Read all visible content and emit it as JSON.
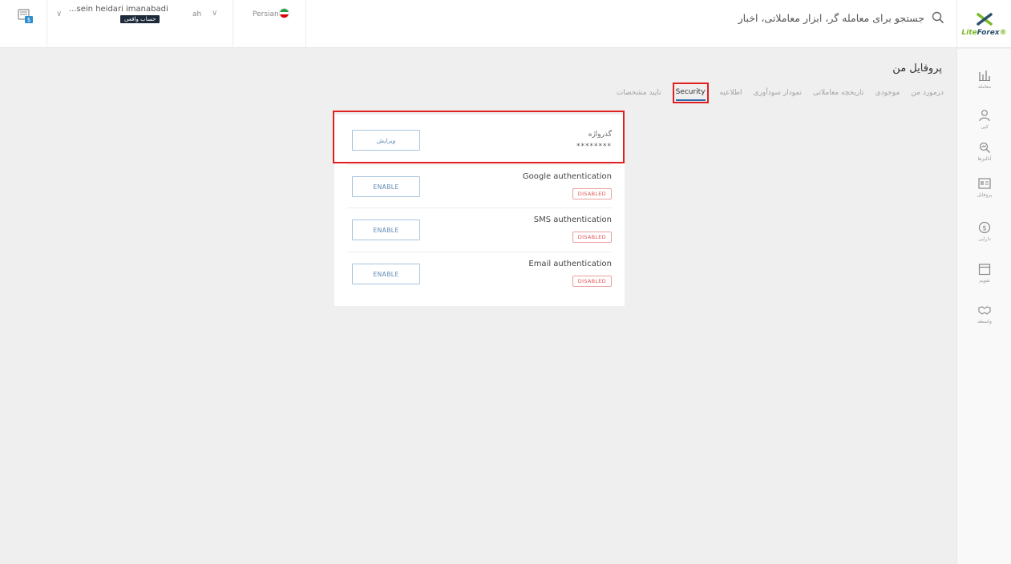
{
  "header": {
    "logo": {
      "main": "Lite",
      "accent": "Forex",
      "trademark": "®"
    },
    "search_text": "جستجو برای معامله گر، ابزار معاملاتی، اخبار",
    "account": {
      "name": "...sein heidari imanabadi",
      "type_badge": "حساب واقعی",
      "short_label": "ah"
    },
    "language": "Persian"
  },
  "sidebar": {
    "items": [
      {
        "label": "معامله",
        "icon": "chart-icon"
      },
      {
        "label": "کپی",
        "icon": "user-copy-icon"
      },
      {
        "label": "آنالیزها",
        "icon": "analytics-icon"
      },
      {
        "label": "پروفایل",
        "icon": "profile-card-icon"
      },
      {
        "label": "دارایی",
        "icon": "dollar-icon"
      },
      {
        "label": "تقویم",
        "icon": "calendar-icon"
      },
      {
        "label": "واسطه",
        "icon": "handshake-icon"
      }
    ]
  },
  "profile": {
    "title": "پروفایل من",
    "tabs": [
      {
        "label": "درمورد من",
        "active": false
      },
      {
        "label": "موجودی",
        "active": false
      },
      {
        "label": "تاریخچه معاملاتی",
        "active": false
      },
      {
        "label": "نمودار سودآوری",
        "active": false
      },
      {
        "label": "اطلاعیه",
        "active": false
      },
      {
        "label": "Security",
        "active": true
      },
      {
        "label": "تایید مشخصات",
        "active": false
      }
    ]
  },
  "security": {
    "password": {
      "title": "گذرواژه",
      "value": "********",
      "button": "ویرایش"
    },
    "rows": [
      {
        "title": "Google authentication",
        "status": "DISABLED",
        "button": "ENABLE"
      },
      {
        "title": "SMS authentication",
        "status": "DISABLED",
        "button": "ENABLE"
      },
      {
        "title": "Email authentication",
        "status": "DISABLED",
        "button": "ENABLE"
      }
    ]
  },
  "colors": {
    "brand_green": "#7bb827",
    "brand_dark": "#2b4f6b",
    "accent_blue": "#2e6aa8",
    "status_red": "#e05555",
    "highlight_red": "#e02020"
  }
}
